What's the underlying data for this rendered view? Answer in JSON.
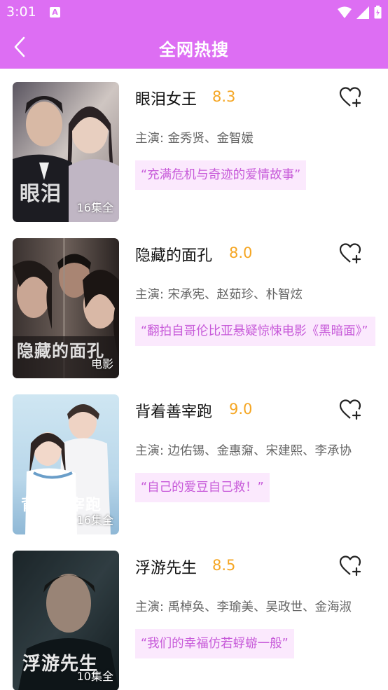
{
  "status_bar": {
    "time": "3:01",
    "a_icon": "A"
  },
  "header": {
    "title": "全网热搜",
    "back_icon": "chevron-left-icon"
  },
  "colors": {
    "accent": "#dd6ef3",
    "rating": "#f5a623",
    "tagline_bg": "#fbe9fd",
    "tagline_text": "#c75ad9"
  },
  "items": [
    {
      "title": "眼泪女王",
      "rating": "8.3",
      "cast": "主演: 金秀贤、金智媛",
      "tagline": "“充满危机与奇迹的爱情故事”",
      "badge": "16集全",
      "poster_art": "眼泪"
    },
    {
      "title": "隐藏的面孔",
      "rating": "8.0",
      "cast": "主演: 宋承宪、赵茹珍、朴智炫",
      "tagline": "“翻拍自哥伦比亚悬疑惊悚电影《黑暗面》”",
      "badge": "电影",
      "poster_art": "隐藏的面孔"
    },
    {
      "title": "背着善宰跑",
      "rating": "9.0",
      "cast": "主演: 边佑锡、金惠奫、宋建熙、李承协",
      "tagline": "“自己的爱豆自己救！”",
      "badge": "16集全",
      "poster_art": "背着善宰跑"
    },
    {
      "title": "浮游先生",
      "rating": "8.5",
      "cast": "主演: 禹棹奂、李瑜美、吴政世、金海淑",
      "tagline": "“我们的幸福仿若蜉蝣一般”",
      "badge": "10集全",
      "poster_art": "浮游先生"
    }
  ]
}
